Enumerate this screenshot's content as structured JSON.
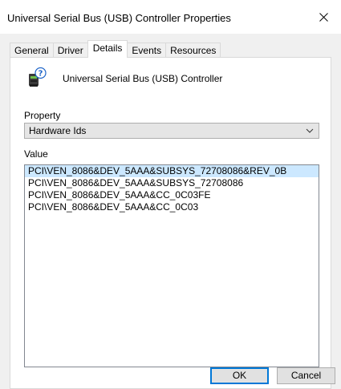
{
  "window": {
    "title": "Universal Serial Bus (USB) Controller Properties"
  },
  "tabs": [
    {
      "label": "General",
      "active": false
    },
    {
      "label": "Driver",
      "active": false
    },
    {
      "label": "Details",
      "active": true
    },
    {
      "label": "Events",
      "active": false
    },
    {
      "label": "Resources",
      "active": false
    }
  ],
  "device": {
    "name": "Universal Serial Bus (USB) Controller",
    "icon": "usb-controller-unknown-icon"
  },
  "property": {
    "label": "Property",
    "selected": "Hardware Ids"
  },
  "value": {
    "label": "Value",
    "items": [
      "PCI\\VEN_8086&DEV_5AAA&SUBSYS_72708086&REV_0B",
      "PCI\\VEN_8086&DEV_5AAA&SUBSYS_72708086",
      "PCI\\VEN_8086&DEV_5AAA&CC_0C03FE",
      "PCI\\VEN_8086&DEV_5AAA&CC_0C03"
    ],
    "selected_index": 0
  },
  "buttons": {
    "ok": "OK",
    "cancel": "Cancel"
  },
  "colors": {
    "selection": "#cce8ff",
    "accent": "#0078d7"
  }
}
